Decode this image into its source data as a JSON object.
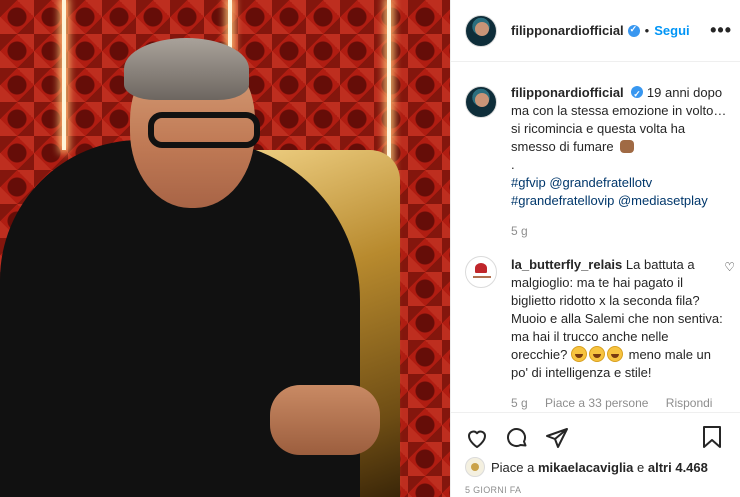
{
  "post": {
    "username": "filipponardiofficial",
    "follow_label": "Segui",
    "more_label": "•••",
    "dot": "•"
  },
  "caption": {
    "username": "filipponardiofficial",
    "text": "19 anni dopo ma con la stessa emozione in volto… si ricomincia e questa volta ha smesso di fumare",
    "dot_line": ".",
    "hashtag_gfvip": "#gfvip",
    "mention_gf": "@grandefratellotv",
    "hashtag_gfvip_full": "#grandefratellovip",
    "mention_mediaset": "@mediasetplay",
    "time": "5 g"
  },
  "comment": {
    "username": "la_butterfly_relais",
    "text": "La battuta a malgioglio: ma te hai pagato il biglietto ridotto x la seconda fila? Muoio e alla Salemi che non sentiva: ma hai il trucco anche nelle orecchie?",
    "text_after": "meno male un po' di intelligenza e stile!",
    "time": "5 g",
    "likes": "Piace a 33 persone",
    "reply": "Rispondi"
  },
  "likes": {
    "prefix": "Piace a",
    "user": "mikaelacaviglia",
    "middle": "e",
    "others": "altri 4.468"
  },
  "date": "5 GIORNI FA",
  "colors": {
    "link": "#00376b",
    "follow": "#0095f6",
    "muted": "#8e8e8e"
  }
}
